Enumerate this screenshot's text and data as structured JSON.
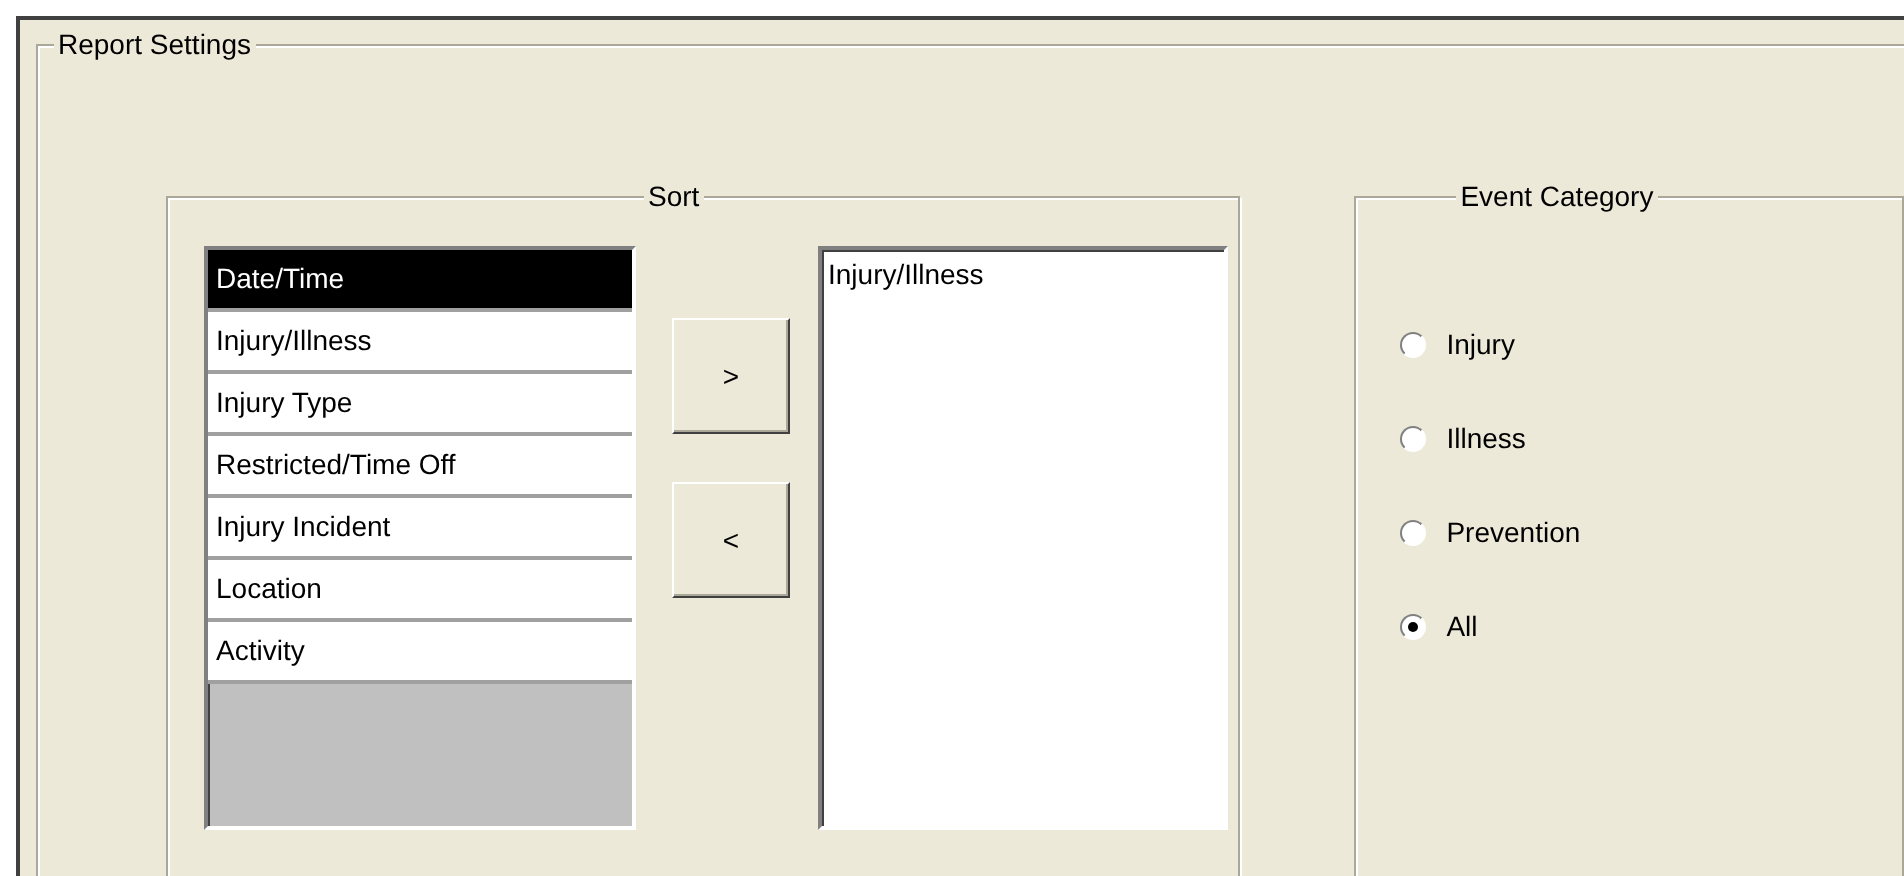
{
  "group": {
    "title": "Report Settings"
  },
  "sort": {
    "title": "Sort",
    "available": [
      {
        "label": "Date/Time",
        "selected": true
      },
      {
        "label": "Injury/Illness",
        "selected": false
      },
      {
        "label": "Injury Type",
        "selected": false
      },
      {
        "label": "Restricted/Time Off",
        "selected": false
      },
      {
        "label": "Injury Incident",
        "selected": false
      },
      {
        "label": "Location",
        "selected": false
      },
      {
        "label": "Activity",
        "selected": false
      }
    ],
    "add_button": ">",
    "remove_button": "<",
    "chosen": [
      {
        "label": "Injury/Illness"
      }
    ]
  },
  "event_category": {
    "title": "Event Category",
    "options": [
      {
        "label": "Injury",
        "selected": false
      },
      {
        "label": "Illness",
        "selected": false
      },
      {
        "label": "Prevention",
        "selected": false
      },
      {
        "label": "All",
        "selected": true
      }
    ]
  }
}
